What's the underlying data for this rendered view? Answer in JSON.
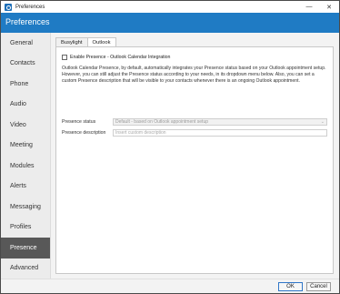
{
  "window": {
    "title": "Preferences",
    "minimize_glyph": "—",
    "close_glyph": "✕"
  },
  "header": {
    "title": "Preferences"
  },
  "sidebar": {
    "items": [
      {
        "label": "General"
      },
      {
        "label": "Contacts"
      },
      {
        "label": "Phone"
      },
      {
        "label": "Audio"
      },
      {
        "label": "Video"
      },
      {
        "label": "Meeting"
      },
      {
        "label": "Modules"
      },
      {
        "label": "Alerts"
      },
      {
        "label": "Messaging"
      },
      {
        "label": "Profiles"
      },
      {
        "label": "Presence",
        "active": true
      },
      {
        "label": "Advanced"
      }
    ]
  },
  "tabs": [
    {
      "label": "Busylight",
      "active": false
    },
    {
      "label": "Outlook",
      "active": true
    }
  ],
  "outlook": {
    "enable_label": "Enable Presence - Outlook Calendar Integration",
    "enable_checked": false,
    "description": "Outlook Calendar Presence, by default, automatically integrates your Presence status based on your Outlook appointment setup. However, you can still adjust the Presence status according to your needs, in its dropdown menu below. Also, you can set a custom Presence description that will be visible to your contacts whenever there is an ongoing Outlook appointment.",
    "presence_status_label": "Presence status",
    "presence_status_value": "Default - based on Outlook appointment setup",
    "presence_description_label": "Presence description",
    "presence_description_placeholder": "Insert custom description"
  },
  "footer": {
    "ok_label": "OK",
    "cancel_label": "Cancel"
  },
  "colors": {
    "header_blue": "#1f7bc4",
    "sidebar_active": "#585858"
  }
}
